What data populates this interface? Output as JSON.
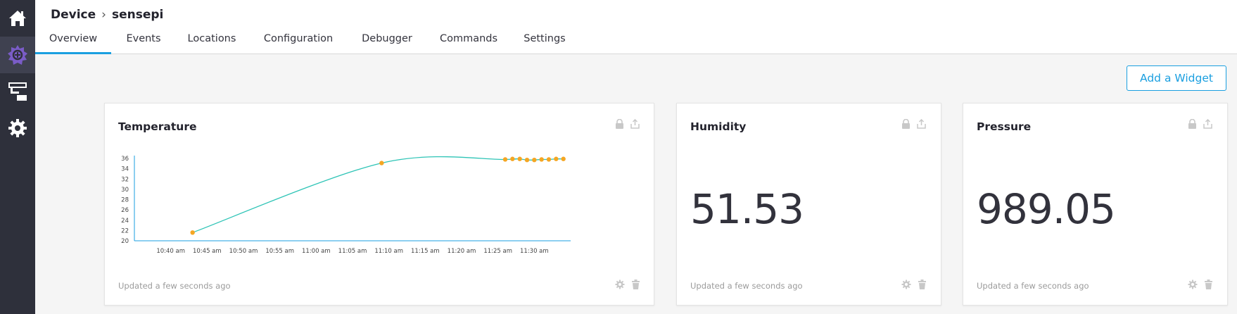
{
  "breadcrumb": {
    "parent": "Device",
    "separator": "›",
    "current": "sensepi"
  },
  "tabs": [
    {
      "label": "Overview",
      "active": true
    },
    {
      "label": "Events",
      "active": false
    },
    {
      "label": "Locations",
      "active": false
    },
    {
      "label": "Configuration",
      "active": false
    },
    {
      "label": "Debugger",
      "active": false
    },
    {
      "label": "Commands",
      "active": false
    },
    {
      "label": "Settings",
      "active": false
    }
  ],
  "sidebar": {
    "items": [
      {
        "icon": "home-icon"
      },
      {
        "icon": "device-icon",
        "active": true
      },
      {
        "icon": "workflow-icon"
      },
      {
        "icon": "gear-icon"
      }
    ]
  },
  "toolbar": {
    "add_widget_label": "Add a Widget"
  },
  "widgets": {
    "temperature": {
      "title": "Temperature",
      "updated": "Updated a few seconds ago"
    },
    "humidity": {
      "title": "Humidity",
      "value": "51.53",
      "updated": "Updated a few seconds ago"
    },
    "pressure": {
      "title": "Pressure",
      "value": "989.05",
      "updated": "Updated a few seconds ago"
    }
  },
  "colors": {
    "accent": "#1a9fe0",
    "line": "#2ec4b6",
    "point": "#f5a623",
    "sidebar": "#2e303b",
    "sidebar_active_icon": "#7a5cc7"
  },
  "chart_data": {
    "type": "line",
    "title": "",
    "xlabel": "",
    "ylabel": "",
    "x_ticks": [
      "10:40 am",
      "10:45 am",
      "10:50 am",
      "10:55 am",
      "11:00 am",
      "11:05 am",
      "11:10 am",
      "11:15 am",
      "11:20 am",
      "11:25 am",
      "11:30 am"
    ],
    "y_ticks": [
      20,
      22,
      24,
      26,
      28,
      30,
      32,
      34,
      36
    ],
    "ylim": [
      20,
      36
    ],
    "xlim_minutes": [
      "10:35 am",
      "11:35 am"
    ],
    "grid": false,
    "series": [
      {
        "x": [
          "10:43 am",
          "11:09 am",
          "11:26 am",
          "11:27 am",
          "11:28 am",
          "11:29 am",
          "11:30 am",
          "11:31 am",
          "11:32 am",
          "11:33 am",
          "11:34 am"
        ],
        "y": [
          21.6,
          35.1,
          35.8,
          35.9,
          35.9,
          35.7,
          35.7,
          35.8,
          35.8,
          35.9,
          35.9
        ]
      }
    ]
  }
}
